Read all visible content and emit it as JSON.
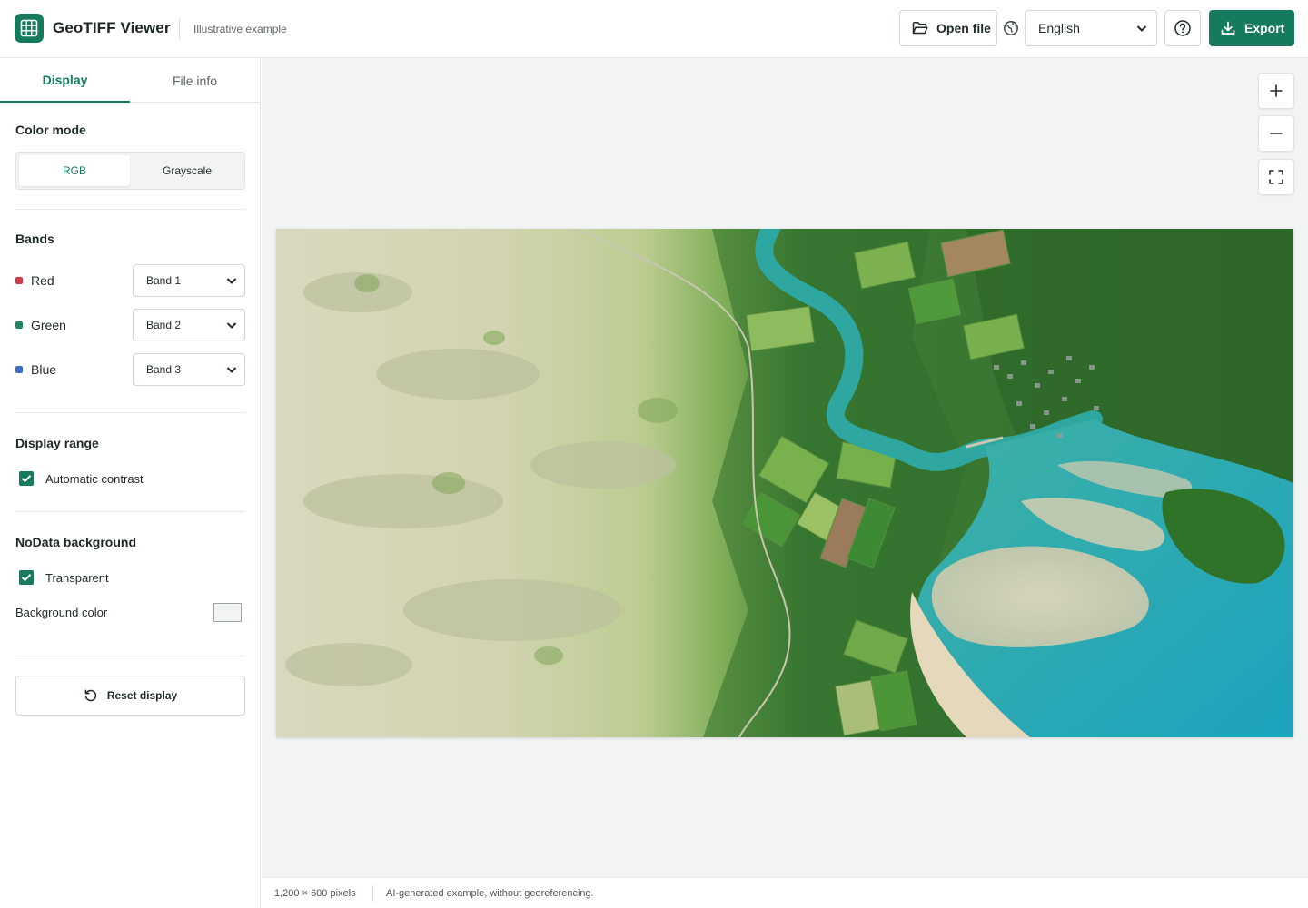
{
  "header": {
    "title": "GeoTIFF Viewer",
    "subtitle": "Illustrative example",
    "open_file_label": "Open file",
    "language": "English",
    "export_label": "Export"
  },
  "sidebar": {
    "tabs": [
      {
        "label": "Display",
        "active": true
      },
      {
        "label": "File info",
        "active": false
      }
    ],
    "color_mode": {
      "title": "Color mode",
      "options": [
        "RGB",
        "Grayscale"
      ],
      "selected": "RGB"
    },
    "bands": {
      "title": "Bands",
      "rows": [
        {
          "label": "Red",
          "value": "Band 1",
          "color": "#d13b47"
        },
        {
          "label": "Green",
          "value": "Band 2",
          "color": "#1e8a5c"
        },
        {
          "label": "Blue",
          "value": "Band 3",
          "color": "#3a6fc4"
        }
      ]
    },
    "display_range": {
      "title": "Display range",
      "automatic_contrast_label": "Automatic contrast",
      "automatic_contrast_checked": true
    },
    "nodata": {
      "title": "NoData background",
      "transparent_label": "Transparent",
      "transparent_checked": true,
      "background_color_label": "Background color",
      "background_color": "#f1f4f3"
    },
    "reset_label": "Reset display"
  },
  "status": {
    "dimensions": "1,200 × 600 pixels",
    "note": "AI-generated example, without georeferencing."
  },
  "colors": {
    "accent": "#157a5e"
  }
}
